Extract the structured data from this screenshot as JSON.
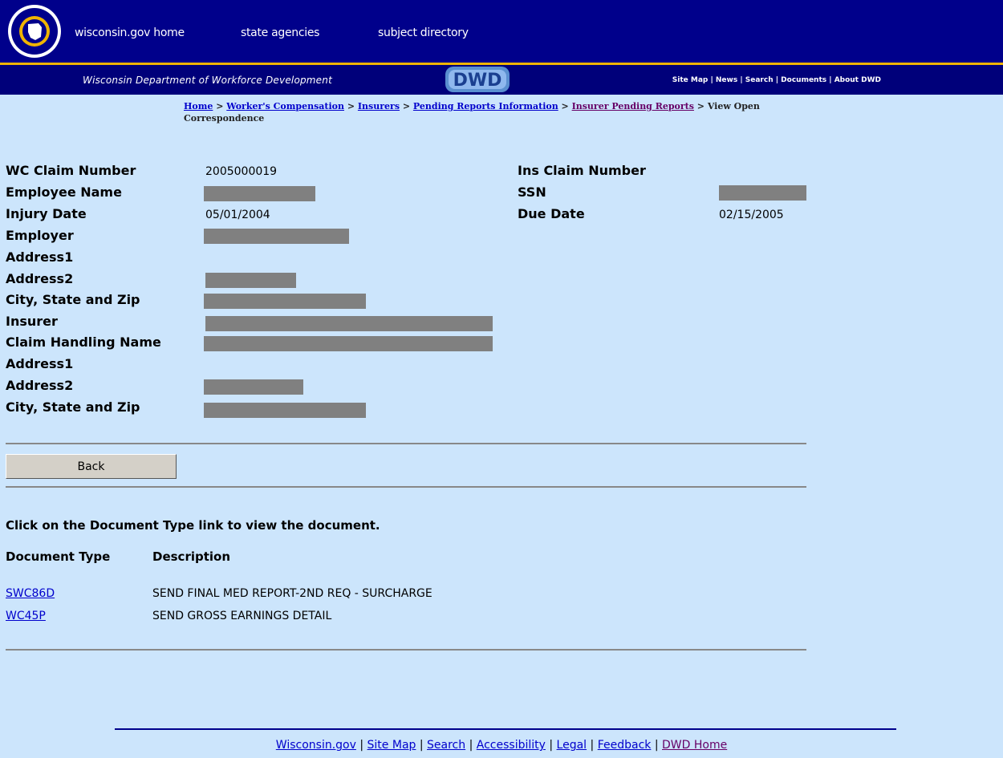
{
  "header": {
    "links": [
      "wisconsin.gov home",
      "state agencies",
      "subject directory"
    ],
    "dept_name": "Wisconsin Department of Workforce Development",
    "logo_text": "DWD",
    "util_links": [
      "Site Map",
      "News",
      "Search",
      "Documents",
      "About DWD"
    ]
  },
  "breadcrumb": {
    "links": [
      "Home",
      "Worker's Compensation",
      "Insurers",
      "Pending Reports Information",
      "Insurer Pending Reports"
    ],
    "current": "View Open Correspondence"
  },
  "claim": {
    "wc_claim_label": "WC Claim Number",
    "wc_claim_value": "2005000019",
    "employee_name_label": "Employee Name",
    "injury_date_label": "Injury Date",
    "injury_date_value": "05/01/2004",
    "employer_label": "Employer",
    "address1_label": "Address1",
    "address2_label": "Address2",
    "city_label": "City, State and Zip",
    "insurer_label": "Insurer",
    "claim_handling_label": "Claim Handling Name",
    "address1b_label": "Address1",
    "address2b_label": "Address2",
    "cityb_label": "City, State and Zip",
    "ins_claim_label": "Ins Claim Number",
    "ssn_label": "SSN",
    "due_date_label": "Due Date",
    "due_date_value": "02/15/2005"
  },
  "back_button": "Back",
  "instruction": "Click on the Document Type link to view the document.",
  "documents": {
    "col_type": "Document Type",
    "col_desc": "Description",
    "rows": [
      {
        "type": "SWC86D",
        "desc": "SEND FINAL MED REPORT-2ND REQ - SURCHARGE"
      },
      {
        "type": "WC45P",
        "desc": "SEND GROSS EARNINGS DETAIL"
      }
    ]
  },
  "footer": {
    "links": [
      "Wisconsin.gov",
      "Site Map",
      "Search",
      "Accessibility",
      "Legal",
      "Feedback",
      "DWD Home"
    ]
  },
  "colors": {
    "background": "#cce5fc",
    "header_blue": "#00008b",
    "gold": "#f0b400",
    "link": "#0000cc",
    "visited_link": "#660066"
  }
}
